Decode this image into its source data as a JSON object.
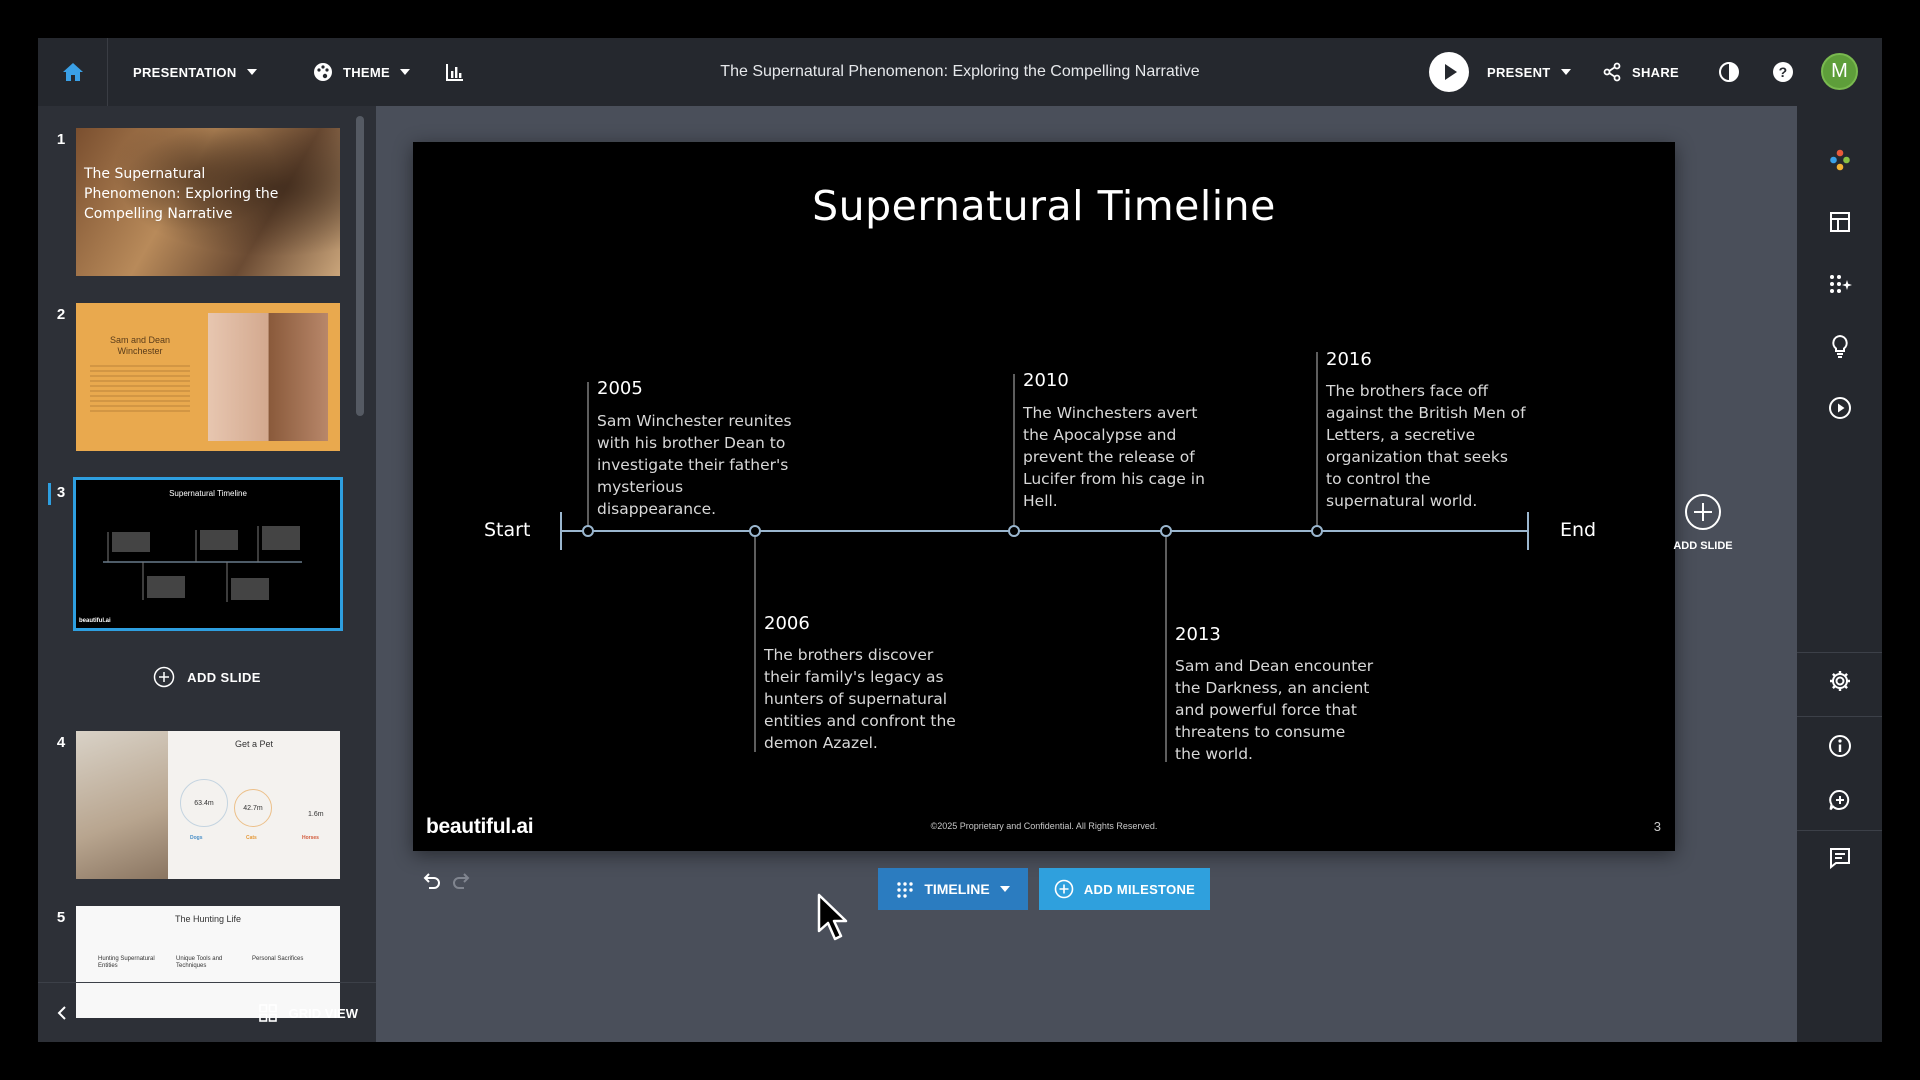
{
  "header": {
    "presentation_label": "PRESENTATION",
    "theme_label": "THEME",
    "doc_title": "The Supernatural Phenomenon: Exploring the Compelling Narrative",
    "present_label": "PRESENT",
    "share_label": "SHARE",
    "avatar_initial": "M"
  },
  "sidebar": {
    "slides": [
      {
        "number": "1",
        "title": "The Supernatural Phenomenon: Exploring the Compelling Narrative"
      },
      {
        "number": "2",
        "title": "Sam and Dean Winchester"
      },
      {
        "number": "3",
        "title": "Supernatural Timeline",
        "brand": "beautiful.ai"
      },
      {
        "number": "4",
        "title": "Get a Pet",
        "stats": [
          "63.4m",
          "42.7m",
          "1.6m"
        ],
        "labels": [
          "Dogs",
          "Cats",
          "Horses"
        ]
      },
      {
        "number": "5",
        "title": "The Hunting Life",
        "columns": [
          "Hunting Supernatural Entities",
          "Unique Tools and Techniques",
          "Personal Sacrifices"
        ]
      }
    ],
    "add_slide_label": "ADD SLIDE",
    "grid_view_label": "GRID VIEW"
  },
  "slide": {
    "title": "Supernatural Timeline",
    "start_label": "Start",
    "end_label": "End",
    "milestones": [
      {
        "year": "2005",
        "text": "Sam Winchester reunites with his brother Dean to investigate their father's mysterious disappearance."
      },
      {
        "year": "2006",
        "text": "The brothers discover their family's legacy as hunters of supernatural entities and confront the demon Azazel."
      },
      {
        "year": "2010",
        "text": "The Winchesters avert the Apocalypse and prevent the release of Lucifer from his cage in Hell."
      },
      {
        "year": "2013",
        "text": "Sam and Dean encounter the Darkness, an ancient and powerful force that threatens to consume the world."
      },
      {
        "year": "2016",
        "text": "The brothers face off against the British Men of Letters, a secretive organization that seeks to control the supernatural world."
      }
    ],
    "brand": "beautiful.ai",
    "footer": "©2025 Proprietary and Confidential. All Rights Reserved.",
    "page_number": "3"
  },
  "canvas_controls": {
    "timeline_label": "TIMELINE",
    "add_milestone_label": "ADD MILESTONE",
    "add_slide_label": "ADD SLIDE"
  },
  "colors": {
    "accent": "#2e9fe0",
    "timeline_line": "#9bb7cf",
    "panel": "#2d3037",
    "topbar": "#25282e",
    "canvas_bg": "#4a4f5a"
  }
}
